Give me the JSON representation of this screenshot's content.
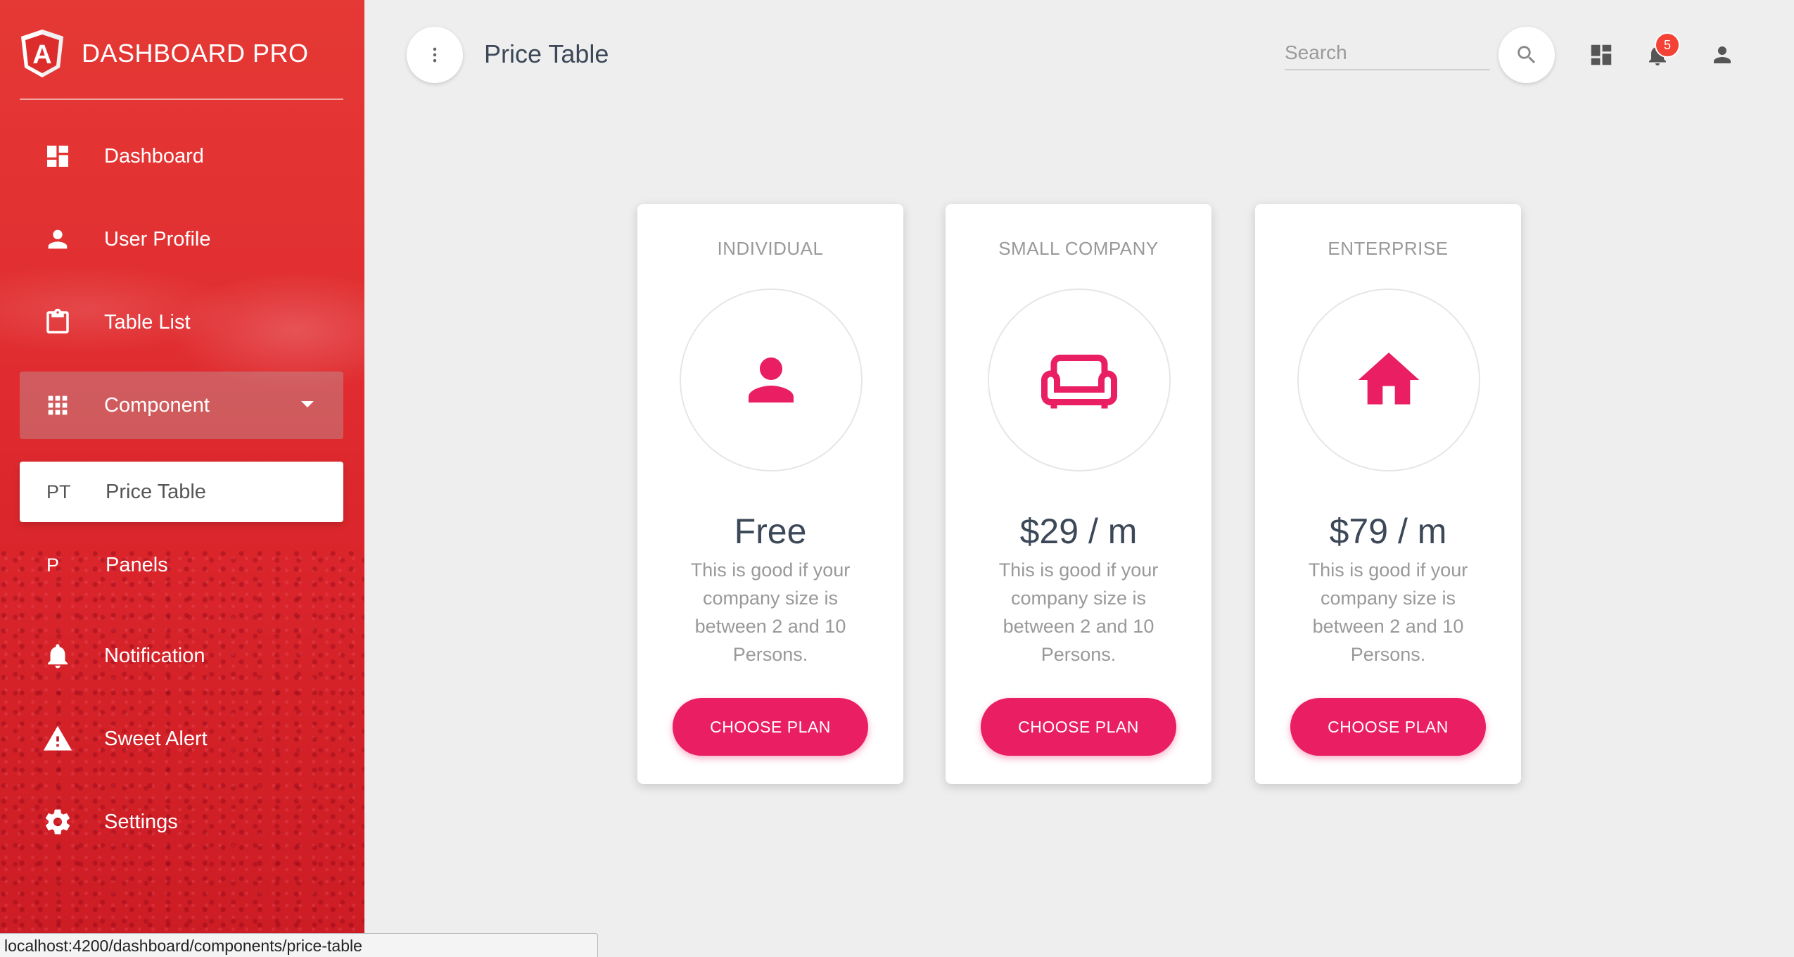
{
  "brand": {
    "title": "DASHBOARD PRO",
    "logo_letter": "A"
  },
  "sidebar": {
    "items": [
      {
        "label": "Dashboard",
        "icon": "dashboard-icon"
      },
      {
        "label": "User Profile",
        "icon": "person-icon"
      },
      {
        "label": "Table List",
        "icon": "clipboard-icon"
      },
      {
        "label": "Component",
        "icon": "apps-grid-icon",
        "expanded": true
      },
      {
        "label": "Notification",
        "icon": "bell-icon"
      },
      {
        "label": "Sweet Alert",
        "icon": "warning-icon"
      },
      {
        "label": "Settings",
        "icon": "gear-icon"
      }
    ],
    "subitems": [
      {
        "abbr": "PT",
        "label": "Price Table",
        "selected": true
      },
      {
        "abbr": "P",
        "label": "Panels",
        "selected": false
      }
    ]
  },
  "header": {
    "title": "Price Table",
    "search_placeholder": "Search",
    "notification_count": "5"
  },
  "plans": [
    {
      "name": "INDIVIDUAL",
      "icon": "person-icon",
      "price": "Free",
      "description": "This is good if your company size is between 2 and 10 Persons.",
      "button": "CHOOSE PLAN"
    },
    {
      "name": "SMALL COMPANY",
      "icon": "sofa-icon",
      "price": "$29 / m",
      "description": "This is good if your company size is between 2 and 10 Persons.",
      "button": "CHOOSE PLAN"
    },
    {
      "name": "ENTERPRISE",
      "icon": "home-icon",
      "price": "$79 / m",
      "description": "This is good if your company size is between 2 and 10 Persons.",
      "button": "CHOOSE PLAN"
    }
  ],
  "status_bar": {
    "url": "localhost:4200/dashboard/components/price-table"
  },
  "colors": {
    "sidebar_red": "#e53935",
    "accent_pink": "#e91e63",
    "badge_red": "#f44336",
    "background": "#eeeeee"
  }
}
